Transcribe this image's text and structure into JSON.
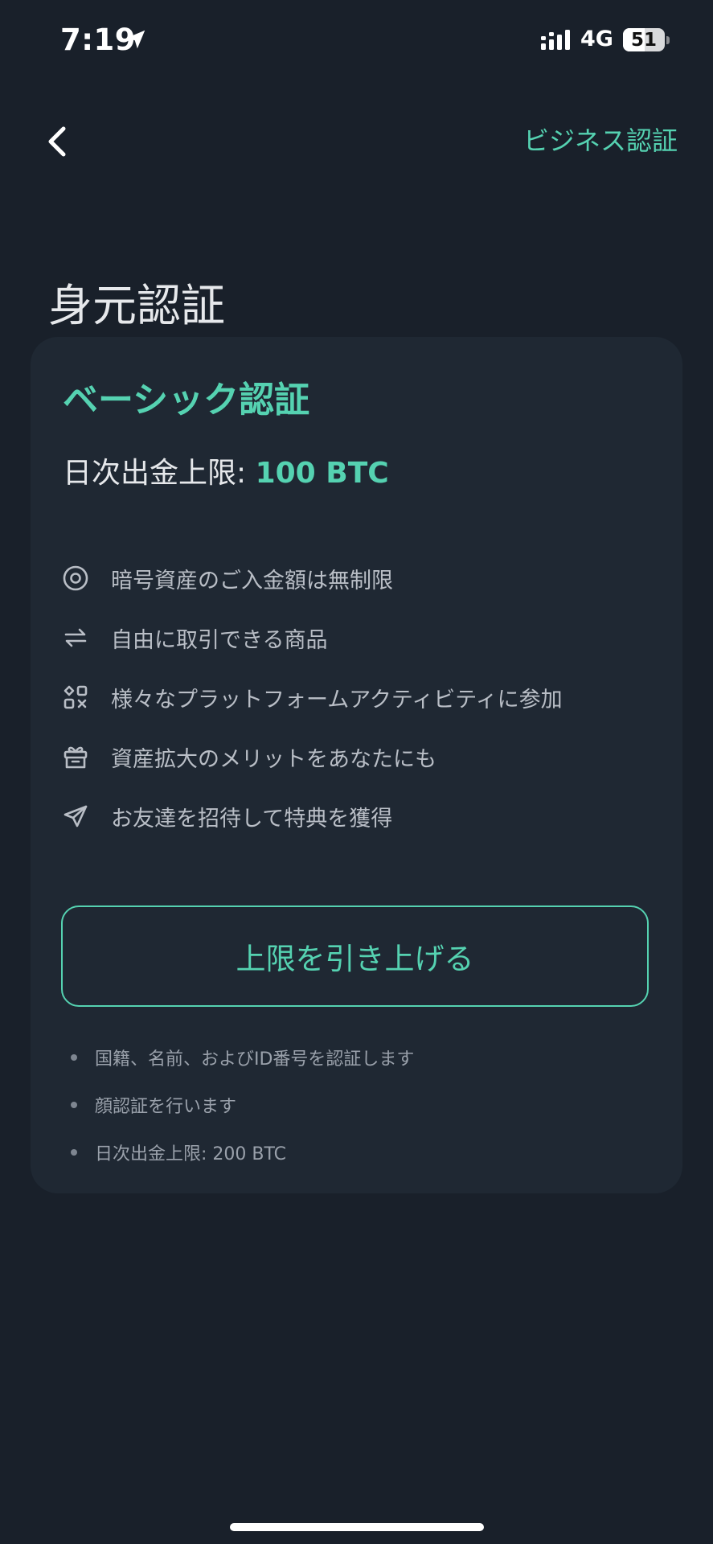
{
  "status_bar": {
    "time": "7:19",
    "network": "4G",
    "battery": "51",
    "battery_level": 0.51
  },
  "nav": {
    "right_link": "ビジネス認証"
  },
  "page_title": "身元認証",
  "card": {
    "title": "ベーシック認証",
    "limit_label": "日次出金上限: ",
    "limit_value": "100 BTC",
    "benefits": [
      {
        "icon": "target-circle-icon",
        "label": "暗号資産のご入金額は無制限"
      },
      {
        "icon": "swap-arrows-icon",
        "label": "自由に取引できる商品"
      },
      {
        "icon": "activities-grid-icon",
        "label": "様々なプラットフォームアクティビティに参加"
      },
      {
        "icon": "gift-icon",
        "label": "資産拡大のメリットをあなたにも"
      },
      {
        "icon": "send-plane-icon",
        "label": "お友達を招待して特典を獲得"
      }
    ],
    "button_label": "上限を引き上げる",
    "requirements": [
      "国籍、名前、およびID番号を認証します",
      "顔認証を行います",
      "日次出金上限: 200 BTC"
    ]
  },
  "colors": {
    "accent": "#55d2b1",
    "background": "#19202a",
    "card": "#1f2833"
  }
}
